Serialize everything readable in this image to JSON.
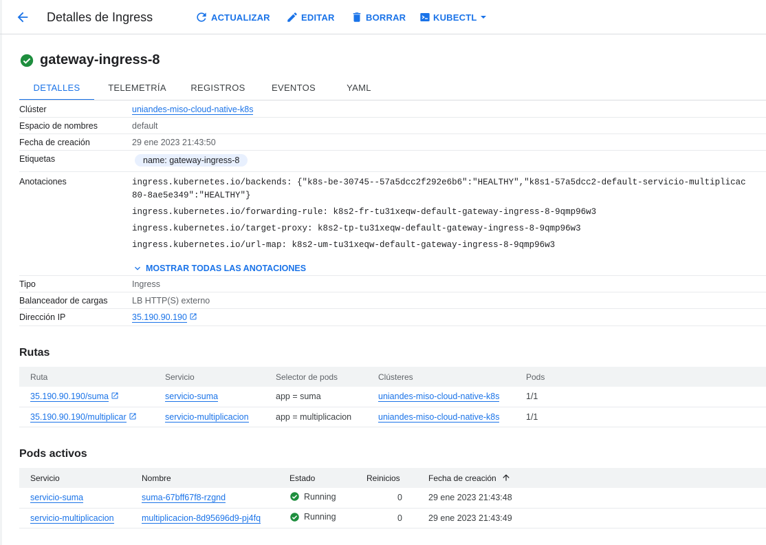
{
  "header": {
    "title": "Detalles de Ingress",
    "refresh_label": "ACTUALIZAR",
    "edit_label": "EDITAR",
    "delete_label": "BORRAR",
    "kubectl_label": "KUBECTL"
  },
  "resource": {
    "name": "gateway-ingress-8",
    "status_color": "#1e8e3e"
  },
  "tabs": [
    {
      "label": "DETALLES"
    },
    {
      "label": "TELEMETRÍA"
    },
    {
      "label": "REGISTROS"
    },
    {
      "label": "EVENTOS"
    },
    {
      "label": "YAML"
    }
  ],
  "details": {
    "cluster_label": "Clúster",
    "cluster_value": "uniandes-miso-cloud-native-k8s",
    "namespace_label": "Espacio de nombres",
    "namespace_value": "default",
    "created_label": "Fecha de creación",
    "created_value": "29 ene 2023 21:43:50",
    "labels_label": "Etiquetas",
    "labels_value": "name: gateway-ingress-8",
    "annotations_label": "Anotaciones",
    "annotations": {
      "a1_line1": "ingress.kubernetes.io/backends: {\"k8s-be-30745--57a5dcc2f292e6b6\":\"HEALTHY\",\"k8s1-57a5dcc2-default-servicio-multiplicac",
      "a1_line2": "80-8ae5e349\":\"HEALTHY\"}",
      "a2": "ingress.kubernetes.io/forwarding-rule: k8s2-fr-tu31xeqw-default-gateway-ingress-8-9qmp96w3",
      "a3": "ingress.kubernetes.io/target-proxy: k8s2-tp-tu31xeqw-default-gateway-ingress-8-9qmp96w3",
      "a4": "ingress.kubernetes.io/url-map: k8s2-um-tu31xeqw-default-gateway-ingress-8-9qmp96w3"
    },
    "show_all_label": "MOSTRAR TODAS LAS ANOTACIONES",
    "type_label": "Tipo",
    "type_value": "Ingress",
    "lb_label": "Balanceador de cargas",
    "lb_value": "LB HTTP(S) externo",
    "ip_label": "Dirección IP",
    "ip_value": "35.190.90.190"
  },
  "routes": {
    "title": "Rutas",
    "columns": [
      "Ruta",
      "Servicio",
      "Selector de pods",
      "Clústeres",
      "Pods"
    ],
    "rows": [
      {
        "route": "35.190.90.190/suma",
        "service": "servicio-suma",
        "selector": "app = suma",
        "cluster": "uniandes-miso-cloud-native-k8s",
        "pods": "1/1"
      },
      {
        "route": "35.190.90.190/multiplicar",
        "service": "servicio-multiplicacion",
        "selector": "app = multiplicacion",
        "cluster": "uniandes-miso-cloud-native-k8s",
        "pods": "1/1"
      }
    ]
  },
  "pods": {
    "title": "Pods activos",
    "columns": [
      "Servicio",
      "Nombre",
      "Estado",
      "Reinicios",
      "Fecha de creación"
    ],
    "rows": [
      {
        "service": "servicio-suma",
        "name": "suma-67bff67f8-rzgnd",
        "status": "Running",
        "restarts": "0",
        "created": "29 ene 2023 21:43:48"
      },
      {
        "service": "servicio-multiplicacion",
        "name": "multiplicacion-8d95696d9-pj4fq",
        "status": "Running",
        "restarts": "0",
        "created": "29 ene 2023 21:43:49"
      }
    ]
  }
}
